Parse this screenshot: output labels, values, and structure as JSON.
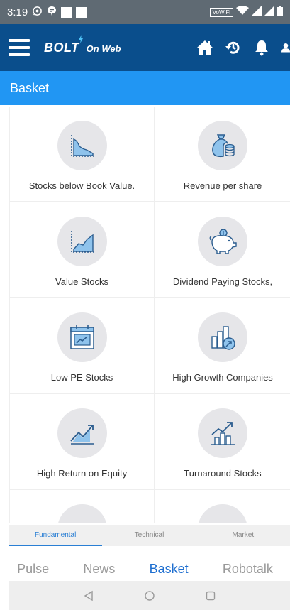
{
  "status_bar": {
    "time": "3:19",
    "vowifi": "VoWiFi",
    "icons": [
      "whatsapp-icon",
      "message-icon",
      "square-icon",
      "square-icon",
      "wifi-icon",
      "signal-icon",
      "signal-icon",
      "battery-icon"
    ]
  },
  "app_bar": {
    "brand": "BOLT",
    "brand_sub": "On Web",
    "icons": [
      "menu-icon",
      "home-icon",
      "history-icon",
      "bell-icon",
      "user-icon"
    ]
  },
  "page": {
    "title": "Basket"
  },
  "tiles": [
    {
      "label": "Stocks below Book Value.",
      "icon": "book-value-chart-icon"
    },
    {
      "label": "Revenue per share",
      "icon": "money-bag-icon"
    },
    {
      "label": "Value Stocks",
      "icon": "value-area-chart-icon"
    },
    {
      "label": "Dividend Paying Stocks,",
      "icon": "piggy-bank-icon"
    },
    {
      "label": "Low PE Stocks",
      "icon": "calendar-trend-icon"
    },
    {
      "label": "High Growth Companies",
      "icon": "bar-growth-icon"
    },
    {
      "label": "High Return on Equity",
      "icon": "trend-up-icon"
    },
    {
      "label": "Turnaround Stocks",
      "icon": "turnaround-chart-icon"
    }
  ],
  "tabs": [
    "Fundamental",
    "Technical",
    "Market"
  ],
  "active_tab": "Fundamental",
  "bottom_nav": [
    "Pulse",
    "News",
    "Basket",
    "Robotalk"
  ],
  "active_nav": "Basket",
  "colors": {
    "app_bar": "#0a4e8c",
    "header": "#2196f3",
    "accent": "#2a7fd4",
    "status_bar": "#5f6a73"
  }
}
